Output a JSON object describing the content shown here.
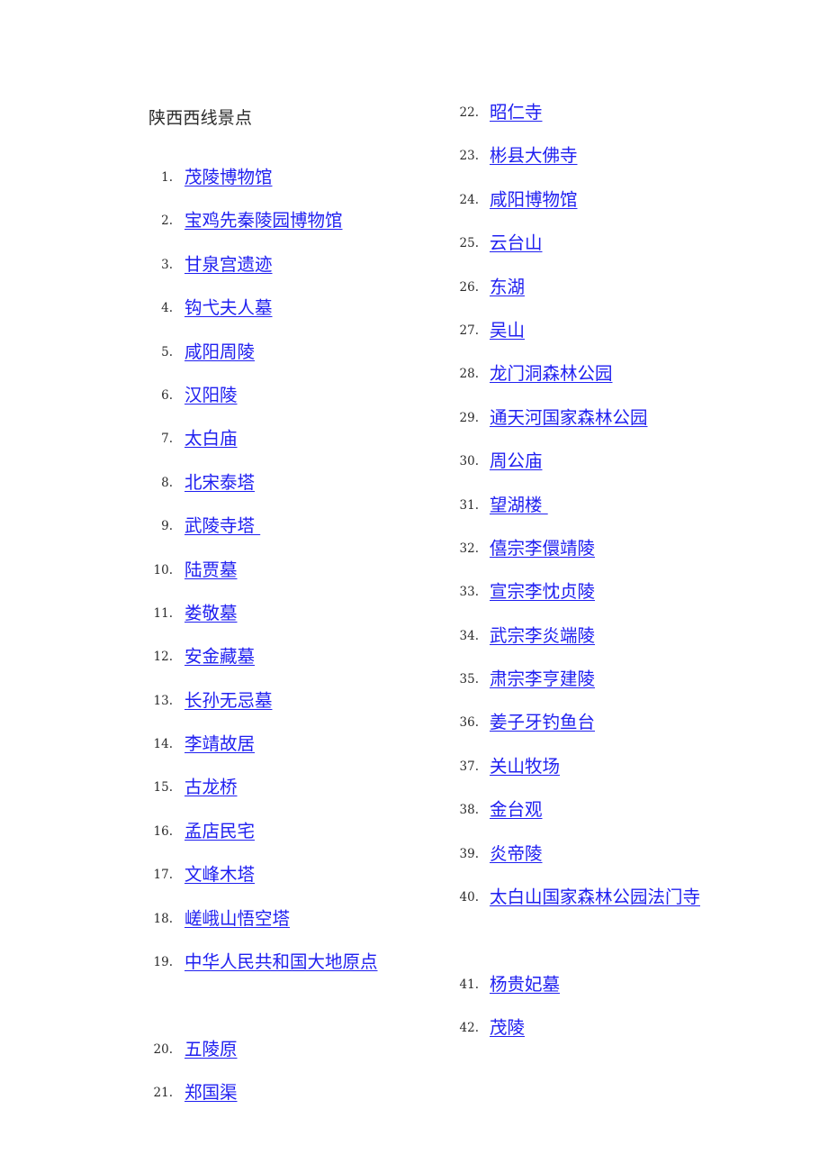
{
  "document": {
    "title": "陕西西线景点",
    "link_color": "#2020f0",
    "text_color": "#2b2b2b",
    "background_color": "#ffffff"
  },
  "columns": {
    "left": [
      {
        "number": "1.",
        "label": "茂陵博物馆"
      },
      {
        "number": "2.",
        "label": "宝鸡先秦陵园博物馆"
      },
      {
        "number": "3.",
        "label": "甘泉宫遗迹"
      },
      {
        "number": "4.",
        "label": "钩弋夫人墓"
      },
      {
        "number": "5.",
        "label": "咸阳周陵"
      },
      {
        "number": "6.",
        "label": "汉阳陵"
      },
      {
        "number": "7.",
        "label": "太白庙"
      },
      {
        "number": "8.",
        "label": "北宋泰塔"
      },
      {
        "number": "9.",
        "label": "武陵寺塔 "
      },
      {
        "number": "10.",
        "label": "陆贾墓"
      },
      {
        "number": "11.",
        "label": "娄敬墓"
      },
      {
        "number": "12.",
        "label": "安金藏墓"
      },
      {
        "number": "13.",
        "label": "长孙无忌墓"
      },
      {
        "number": "14.",
        "label": "李靖故居"
      },
      {
        "number": "15.",
        "label": "古龙桥"
      },
      {
        "number": "16.",
        "label": "孟店民宅"
      },
      {
        "number": "17.",
        "label": "文峰木塔"
      },
      {
        "number": "18.",
        "label": "嵯峨山悟空塔"
      },
      {
        "number": "19.",
        "label": "中华人民共和国大地原点"
      },
      {
        "number": "20.",
        "label": "五陵原"
      },
      {
        "number": "21.",
        "label": "郑国渠"
      }
    ],
    "right": [
      {
        "number": "22.",
        "label": "昭仁寺"
      },
      {
        "number": "23.",
        "label": "彬县大佛寺"
      },
      {
        "number": "24.",
        "label": "咸阳博物馆"
      },
      {
        "number": "25.",
        "label": "云台山"
      },
      {
        "number": "26.",
        "label": "东湖"
      },
      {
        "number": "27.",
        "label": "吴山"
      },
      {
        "number": "28.",
        "label": "龙门洞森林公园"
      },
      {
        "number": "29.",
        "label": "通天河国家森林公园"
      },
      {
        "number": "30.",
        "label": "周公庙"
      },
      {
        "number": "31.",
        "label": "望湖楼 "
      },
      {
        "number": "32.",
        "label": "僖宗李儇靖陵"
      },
      {
        "number": "33.",
        "label": "宣宗李忱贞陵"
      },
      {
        "number": "34.",
        "label": "武宗李炎端陵"
      },
      {
        "number": "35.",
        "label": "肃宗李亨建陵"
      },
      {
        "number": "36.",
        "label": "姜子牙钓鱼台"
      },
      {
        "number": "37.",
        "label": "关山牧场"
      },
      {
        "number": "38.",
        "label": "金台观"
      },
      {
        "number": "39.",
        "label": "炎帝陵"
      },
      {
        "number": "40.",
        "label": "太白山国家森林公园法门寺"
      },
      {
        "number": "41.",
        "label": "杨贵妃墓"
      },
      {
        "number": "42.",
        "label": "茂陵"
      }
    ]
  }
}
